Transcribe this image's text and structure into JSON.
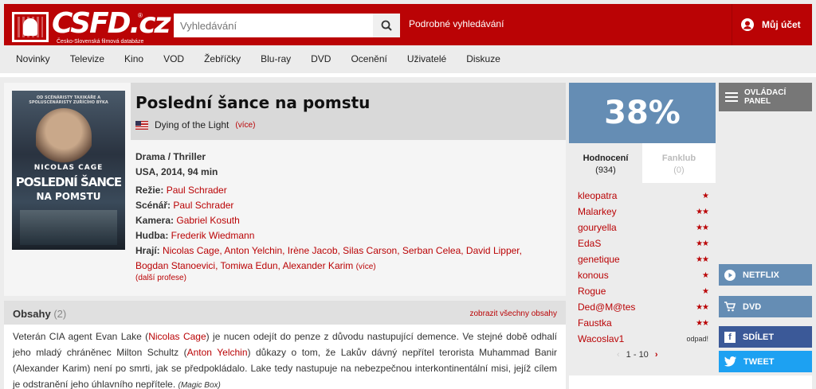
{
  "header": {
    "logo_text": "CSFD.cz",
    "logo_subtitle": "Česko-Slovenská filmová databáze",
    "search_placeholder": "Vyhledávání",
    "advanced_search": "Podrobné vyhledávání",
    "account": "Můj účet"
  },
  "nav": [
    "Novinky",
    "Televize",
    "Kino",
    "VOD",
    "Žebříčky",
    "Blu-ray",
    "DVD",
    "Ocenění",
    "Uživatelé",
    "Diskuze"
  ],
  "film": {
    "title": "Poslední šance na pomstu",
    "original_title": "Dying of the Light",
    "more": "(více)",
    "genre": "Drama / Thriller",
    "origin": "USA, 2014, 94 min",
    "poster": {
      "top": "OD SCÉNÁRISTY TAXIKÁŘE A SPOLUSCÉNÁRISTY ZUŘÍCÍHO BÝKA",
      "actor": "NICOLAS CAGE",
      "title1": "POSLEDNÍ ŠANCE",
      "title2": "NA POMSTU"
    },
    "crew": {
      "directing_label": "Režie:",
      "directing": "Paul Schrader",
      "writing_label": "Scénář:",
      "writing": "Paul Schrader",
      "camera_label": "Kamera:",
      "camera": "Gabriel Kosuth",
      "music_label": "Hudba:",
      "music": "Frederik Wiedmann",
      "cast_label": "Hrají:",
      "cast": "Nicolas Cage, Anton Yelchin, Irène Jacob, Silas Carson, Serban Celea, David Lipper, Bogdan Stanoevici, Tomiwa Edun, Alexander Karim",
      "cast_more": "(více)"
    },
    "more_professions": "(další profese)"
  },
  "plots": {
    "title": "Obsahy",
    "count": "(2)",
    "show_all": "zobrazit všechny obsahy",
    "text_1": "Veterán CIA agent Evan Lake (",
    "link_1": "Nicolas Cage",
    "text_2": ") je nucen odejít do penze z důvodu nastupující demence. Ve stejné době odhalí jeho mladý chráněnec Milton Schultz (",
    "link_2": "Anton Yelchin",
    "text_3": ") důkazy o tom, že Lakův dávný nepřítel terorista Muhammad Banir (Alexander Karim) není po smrti, jak se předpokládalo. Lake tedy nastupuje na nebezpečnou interkontinentální misi, jejíž cílem je odstranění jeho úhlavního nepřítele.",
    "source": "(Magic Box)"
  },
  "rating": {
    "percent": "38%",
    "tab_ratings": "Hodnocení",
    "tab_ratings_count": "(934)",
    "tab_fanclub": "Fanklub",
    "tab_fanclub_count": "(0)",
    "users": [
      {
        "name": "kleopatra",
        "stars": "★"
      },
      {
        "name": "Malarkey",
        "stars": "★★"
      },
      {
        "name": "gouryella",
        "stars": "★★"
      },
      {
        "name": "EdaS",
        "stars": "★★"
      },
      {
        "name": "genetique",
        "stars": "★★"
      },
      {
        "name": "konous",
        "stars": "★"
      },
      {
        "name": "Rogue",
        "stars": "★"
      },
      {
        "name": "Ded@M@tes",
        "stars": "★★"
      },
      {
        "name": "Faustka",
        "stars": "★★"
      },
      {
        "name": "Wacoslav1",
        "stars": "odpad!"
      }
    ],
    "pager": "1 - 10"
  },
  "sidebar": {
    "control_panel_1": "OVLÁDACÍ",
    "control_panel_2": "PANEL",
    "netflix": "NETFLIX",
    "dvd": "DVD",
    "share": "SDÍLET",
    "tweet": "TWEET"
  },
  "colors": {
    "brand": "#ba0305",
    "rating_blue": "#658db4",
    "facebook": "#3b5998",
    "twitter": "#1da1f2"
  }
}
